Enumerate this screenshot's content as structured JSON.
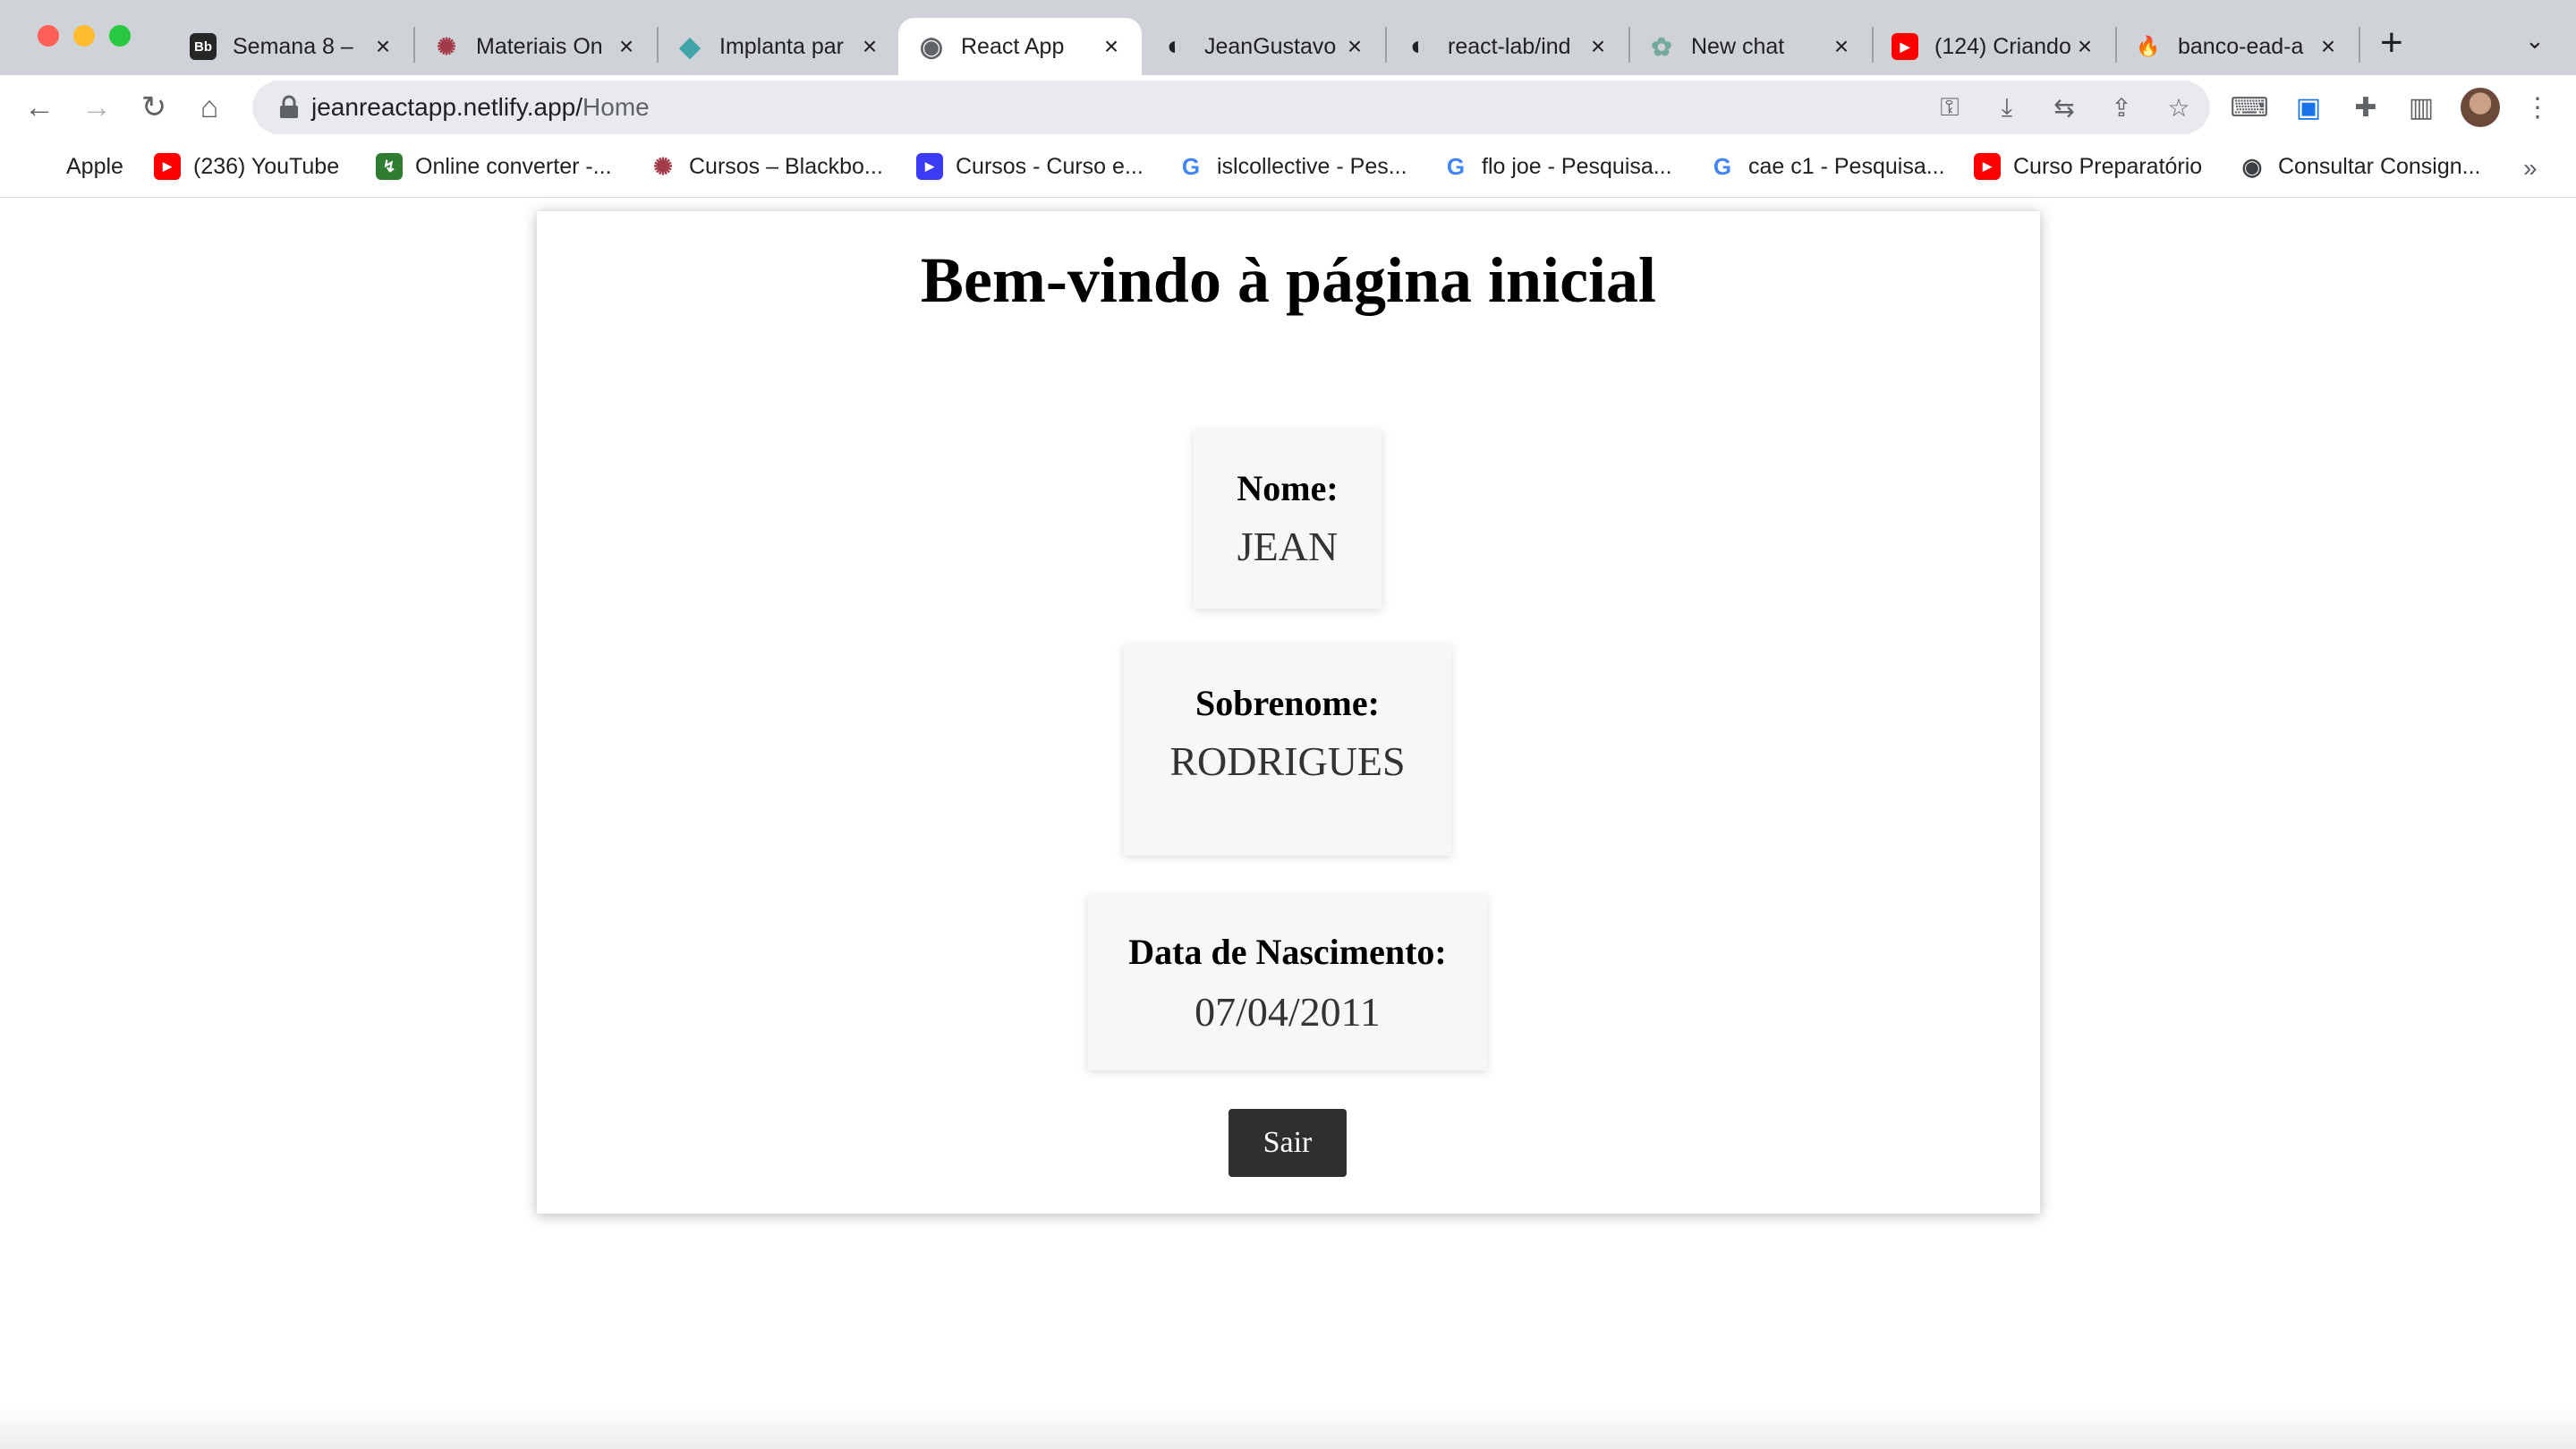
{
  "browser": {
    "tabs": [
      {
        "title": "Semana 8 –",
        "fav": "Bb",
        "fav_color": "#262626"
      },
      {
        "title": "Materiais On",
        "fav": "✺",
        "fav_color": "#a23a4a"
      },
      {
        "title": "Implanta par",
        "fav": "◆",
        "fav_color": "#3fa5a8"
      },
      {
        "title": "React App",
        "fav": "◉",
        "fav_color": "#5f6368",
        "active": true
      },
      {
        "title": "JeanGustavo",
        "fav": "◐",
        "fav_color": "#202124"
      },
      {
        "title": "react-lab/ind",
        "fav": "◐",
        "fav_color": "#202124"
      },
      {
        "title": "New chat",
        "fav": "✿",
        "fav_color": "#74aa9c"
      },
      {
        "title": "(124) Criando",
        "fav": "▶",
        "fav_color": "#ff0000"
      },
      {
        "title": "banco-ead-a",
        "fav": "🔥",
        "fav_color": "#f5b800"
      }
    ],
    "tab_close": "×",
    "new_tab": "+",
    "url_host": "jeanreactapp.netlify.app/",
    "url_path": "Home",
    "bookmarks": [
      {
        "label": "Apple",
        "icon": "",
        "color": "#000000"
      },
      {
        "label": "(236) YouTube",
        "icon": "▶",
        "color": "#ff0000"
      },
      {
        "label": "Online converter -...",
        "icon": "↯",
        "color": "#2e7d32"
      },
      {
        "label": "Cursos – Blackbo...",
        "icon": "✺",
        "color": "#a23a4a"
      },
      {
        "label": "Cursos - Curso e...",
        "icon": "▶",
        "color": "#3b3bf5"
      },
      {
        "label": "islcollective - Pes...",
        "icon": "G",
        "color": "#4285f4"
      },
      {
        "label": "flo joe - Pesquisa...",
        "icon": "G",
        "color": "#4285f4"
      },
      {
        "label": "cae c1 - Pesquisa...",
        "icon": "G",
        "color": "#4285f4"
      },
      {
        "label": "Curso Preparatório",
        "icon": "▶",
        "color": "#ff0000"
      },
      {
        "label": "Consultar Consign...",
        "icon": "◉",
        "color": "#3c4043"
      }
    ],
    "bookmarks_more": "»"
  },
  "page": {
    "title": "Bem-vindo à página inicial",
    "fields": [
      {
        "label": "Nome:",
        "value": "JEAN"
      },
      {
        "label": "Sobrenome:",
        "value": "RODRIGUES"
      },
      {
        "label": "Data de Nascimento:",
        "value": "07/04/2011"
      }
    ],
    "logout_label": "Sair"
  }
}
